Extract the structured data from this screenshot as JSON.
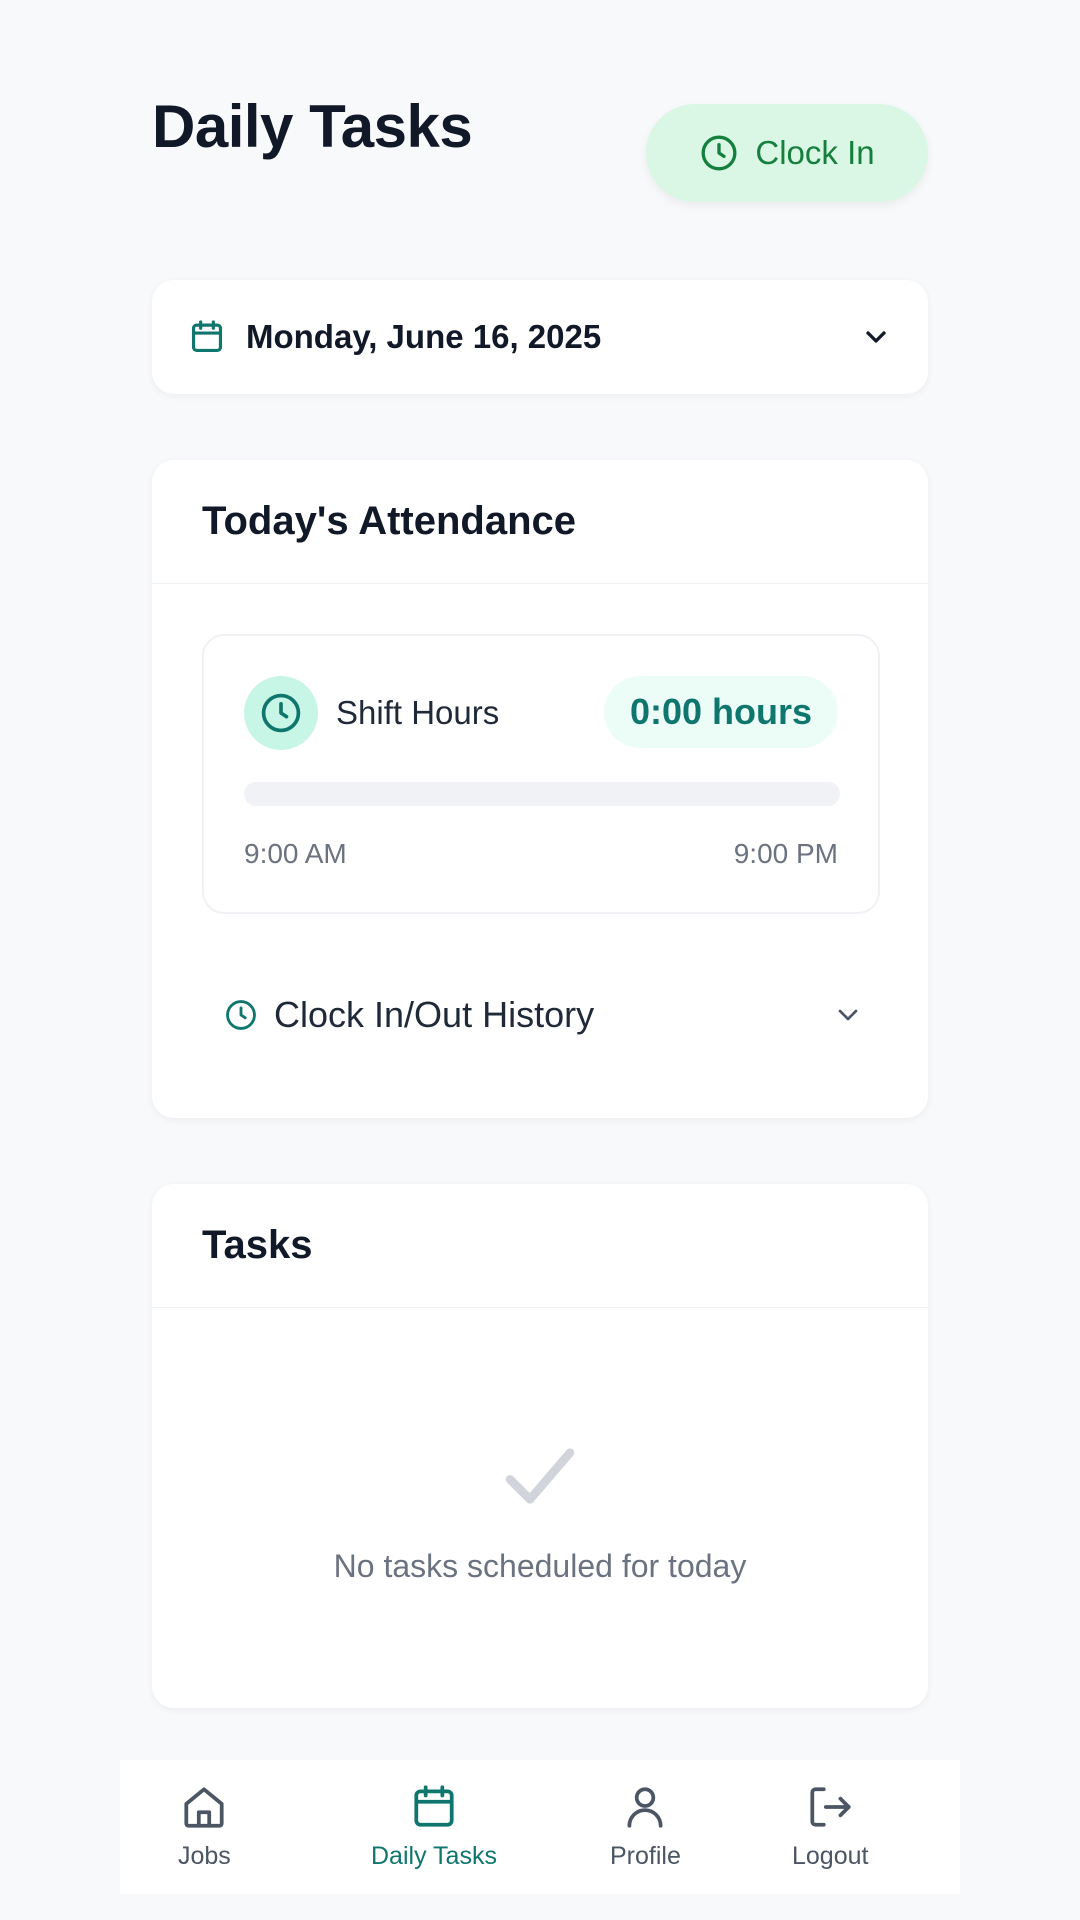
{
  "header": {
    "title": "Daily Tasks",
    "clock_in_label": "Clock In"
  },
  "date_selector": {
    "value": "Monday, June 16, 2025"
  },
  "attendance": {
    "title": "Today's Attendance",
    "shift_label": "Shift Hours",
    "hours_value": "0:00 hours",
    "progress_fraction": 0,
    "start_time": "9:00 AM",
    "end_time": "9:00 PM",
    "history_label": "Clock In/Out History"
  },
  "tasks": {
    "title": "Tasks",
    "empty_message": "No tasks scheduled for today"
  },
  "bottom_nav": {
    "items": [
      {
        "label": "Jobs",
        "icon": "home-icon"
      },
      {
        "label": "Daily Tasks",
        "icon": "calendar-icon",
        "active": true
      },
      {
        "label": "Profile",
        "icon": "user-icon"
      },
      {
        "label": "Logout",
        "icon": "logout-icon"
      }
    ]
  },
  "colors": {
    "accent": "#0f766e",
    "clock_in_bg": "#d9f7e4",
    "clock_in_text": "#15803d",
    "page_bg": "#f8f9fb"
  }
}
